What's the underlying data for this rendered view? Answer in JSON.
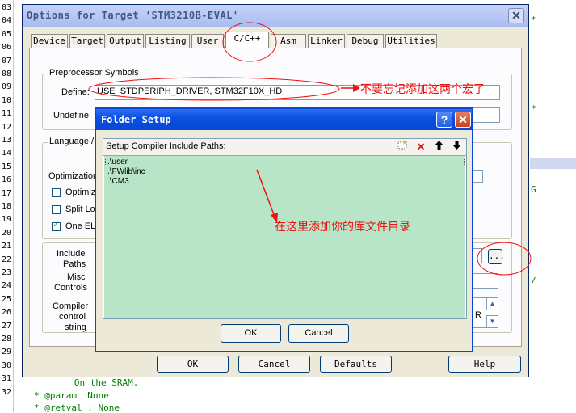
{
  "editor": {
    "line_numbers": [
      "03",
      "04",
      "05",
      "06",
      "07",
      "08",
      "09",
      "10",
      "11",
      "12",
      "13",
      "14",
      "15",
      "16",
      "17",
      "18",
      "19",
      "20",
      "21",
      "22",
      "23",
      "24",
      "25",
      "26",
      "27",
      "28",
      "29",
      "30",
      "31",
      "32"
    ],
    "code_fragments": {
      "right_star1": "*",
      "right_star2": "*",
      "right_g": "G",
      "right_slash": "/",
      "bottom1": "   On the SRAM.",
      "bottom2": "* @param  None",
      "bottom3": "* @retval : None"
    }
  },
  "main_dialog": {
    "title": "Options for Target 'STM3210B-EVAL'",
    "close_glyph": "✕",
    "tabs": [
      "Device",
      "Target",
      "Output",
      "Listing",
      "User",
      "C/C++",
      "Asm",
      "Linker",
      "Debug",
      "Utilities"
    ],
    "active_tab": "C/C++",
    "preprocessor": {
      "group_label": "Preprocessor Symbols",
      "define_label": "Define:",
      "define_value": "USE_STDPERIPH_DRIVER, STM32F10X_HD",
      "undefine_label": "Undefine:"
    },
    "language": {
      "group_label": "Language /",
      "optimization_label": "Optimization",
      "checks": [
        {
          "label": "Optimize",
          "checked": false
        },
        {
          "label": "Split Loa",
          "checked": false
        },
        {
          "label": "One ELF",
          "checked": true
        }
      ]
    },
    "include_label_1": "Include",
    "include_label_2": "Paths",
    "misc_label_1": "Misc",
    "misc_label_2": "Controls",
    "compiler_label_1": "Compiler",
    "compiler_label_2": "control",
    "compiler_label_3": "string",
    "browse_button": "...",
    "partial_r": "R",
    "buttons": {
      "ok": "OK",
      "cancel": "Cancel",
      "defaults": "Defaults",
      "help": "Help"
    }
  },
  "folder_dialog": {
    "title": "Folder Setup",
    "help_glyph": "?",
    "close_glyph": "✕",
    "header": "Setup Compiler Include Paths:",
    "paths": [
      ".\\user",
      ".\\FWlib\\inc",
      ".\\CM3"
    ],
    "ok": "OK",
    "cancel": "Cancel"
  },
  "annotations": {
    "define_note": "不要忘记添加这两个宏了",
    "folder_note": "在这里添加你的库文件目录"
  },
  "colors": {
    "annotation_red": "#ee1111",
    "list_green": "#b8e4c7",
    "folder_title_blue": "#0a52e4"
  }
}
